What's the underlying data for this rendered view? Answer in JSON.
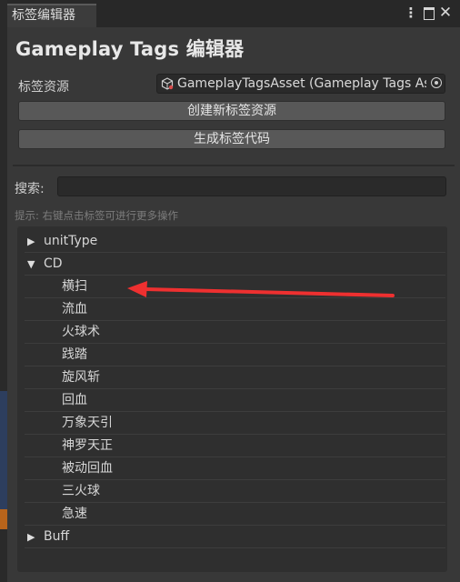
{
  "window": {
    "tab_title": "标签编辑器",
    "kebab_glyph": "⋮",
    "close_glyph": "✕"
  },
  "header": {
    "title": "Gameplay Tags 编辑器"
  },
  "asset": {
    "label": "标签资源",
    "value": "GameplayTagsAsset (Gameplay Tags Asset)"
  },
  "buttons": {
    "create_asset": "创建新标签资源",
    "generate_code": "生成标签代码"
  },
  "search": {
    "label": "搜索:",
    "value": "",
    "placeholder": ""
  },
  "hint": "提示: 右键点击标签可进行更多操作",
  "tree": {
    "rows": [
      {
        "label": "unitType",
        "level": 0,
        "expanded": false,
        "arrow": "▶"
      },
      {
        "label": "CD",
        "level": 0,
        "expanded": true,
        "arrow": "▼"
      },
      {
        "label": "横扫",
        "level": 1
      },
      {
        "label": "流血",
        "level": 1
      },
      {
        "label": "火球术",
        "level": 1
      },
      {
        "label": "践踏",
        "level": 1
      },
      {
        "label": "旋风斩",
        "level": 1
      },
      {
        "label": "回血",
        "level": 1
      },
      {
        "label": "万象天引",
        "level": 1
      },
      {
        "label": "神罗天正",
        "level": 1
      },
      {
        "label": "被动回血",
        "level": 1
      },
      {
        "label": "三火球",
        "level": 1
      },
      {
        "label": "急速",
        "level": 1
      },
      {
        "label": "Buff",
        "level": 0,
        "expanded": false,
        "arrow": "▶"
      }
    ]
  },
  "colors": {
    "panel_bg": "#383838",
    "titlebar_bg": "#282828",
    "button_bg": "#585858",
    "tree_bg": "#2f2f2f",
    "annotation_arrow": "#ee3030"
  }
}
